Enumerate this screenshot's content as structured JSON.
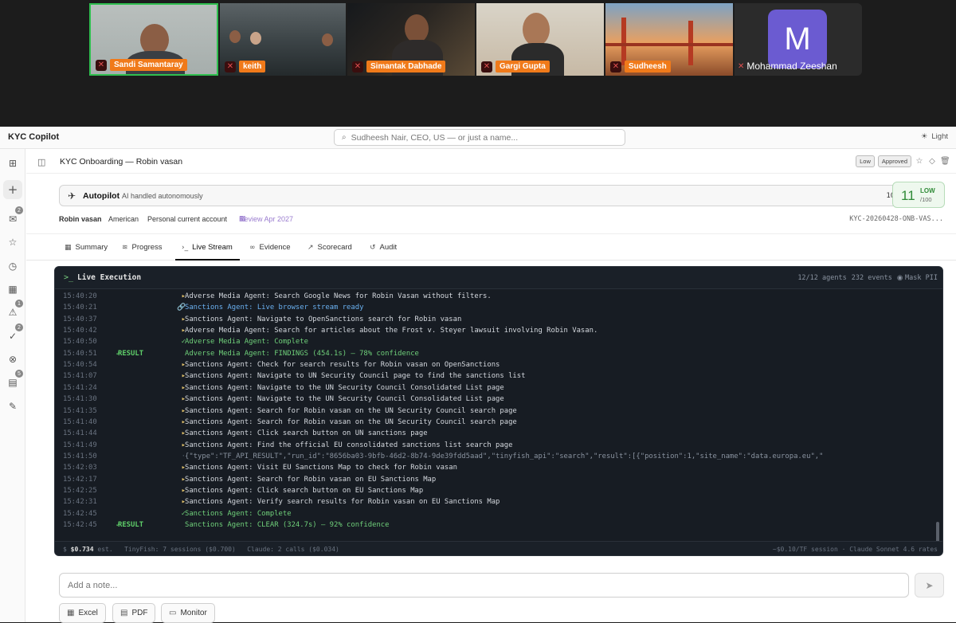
{
  "video_strip": {
    "participants": [
      {
        "name": "Sandi Samantaray"
      },
      {
        "name": "keith"
      },
      {
        "name": "Simantak Dabhade"
      },
      {
        "name": "Gargi Gupta"
      },
      {
        "name": "Sudheesh"
      },
      {
        "name": "Mohammad Zeeshan",
        "initial": "M",
        "avatar_color": "#6b5bd1"
      }
    ],
    "active_speaker_color": "#2fbf4f",
    "name_tag_color": "#f07a1a"
  },
  "app": {
    "brand": "KYC Copilot",
    "search_placeholder": "Sudheesh Nair, CEO, US — or just a name...",
    "theme_label": "Light",
    "rail_badges": {
      "inbox": "2",
      "alerts": "1",
      "checks": "2",
      "archive": "5"
    }
  },
  "header": {
    "title": "KYC Onboarding — Robin vasan",
    "risk_pill": "Low",
    "status_pill": "Approved"
  },
  "autopilot": {
    "label": "Autopilot",
    "subtitle": "AI handled autonomously",
    "percent": "100%"
  },
  "score": {
    "value": "11",
    "level": "LOW",
    "out_of": "/100",
    "color": "#2e8a36"
  },
  "meta": {
    "name": "Robin vasan",
    "nationality": "American",
    "account": "Personal current account",
    "review": "Review Apr 2027",
    "case_id": "KYC-20260428-ONB-VAS..."
  },
  "tabs": [
    {
      "label": "Summary",
      "icon": "grid-icon"
    },
    {
      "label": "Progress",
      "icon": "layers-icon"
    },
    {
      "label": "Live Stream",
      "icon": "terminal-icon"
    },
    {
      "label": "Evidence",
      "icon": "link-icon"
    },
    {
      "label": "Scorecard",
      "icon": "trend-icon"
    },
    {
      "label": "Audit",
      "icon": "history-icon"
    }
  ],
  "terminal": {
    "title": "Live Execution",
    "agents": "12/12 agents",
    "events": "232 events",
    "mask": "Mask PII",
    "logs": [
      {
        "t": "15:40:20",
        "kind": "step",
        "text": "Adverse Media Agent: Search Google News for Robin Vasan without filters."
      },
      {
        "t": "15:40:21",
        "kind": "link",
        "text": "Sanctions Agent: Live browser stream ready"
      },
      {
        "t": "15:40:37",
        "kind": "step",
        "text": "Sanctions Agent: Navigate to OpenSanctions search for Robin vasan"
      },
      {
        "t": "15:40:42",
        "kind": "step",
        "text": "Adverse Media Agent: Search for articles about the Frost v. Steyer lawsuit involving Robin Vasan."
      },
      {
        "t": "15:40:50",
        "kind": "done",
        "text": "Adverse Media Agent: Complete"
      },
      {
        "t": "15:40:51",
        "kind": "result",
        "text": "Adverse Media Agent: FINDINGS (454.1s) — 78% confidence"
      },
      {
        "t": "15:40:54",
        "kind": "step",
        "text": "Sanctions Agent: Check for search results for Robin vasan on OpenSanctions"
      },
      {
        "t": "15:41:07",
        "kind": "step",
        "text": "Sanctions Agent: Navigate to UN Security Council page to find the sanctions list"
      },
      {
        "t": "15:41:24",
        "kind": "step",
        "text": "Sanctions Agent: Navigate to the UN Security Council Consolidated List page"
      },
      {
        "t": "15:41:30",
        "kind": "step",
        "text": "Sanctions Agent: Navigate to the UN Security Council Consolidated List page"
      },
      {
        "t": "15:41:35",
        "kind": "step",
        "text": "Sanctions Agent: Search for Robin vasan on the UN Security Council search page"
      },
      {
        "t": "15:41:40",
        "kind": "step",
        "text": "Sanctions Agent: Search for Robin vasan on the UN Security Council search page"
      },
      {
        "t": "15:41:44",
        "kind": "step",
        "text": "Sanctions Agent: Click search button on UN sanctions page"
      },
      {
        "t": "15:41:49",
        "kind": "step",
        "text": "Sanctions Agent: Find the official EU consolidated sanctions list search page"
      },
      {
        "t": "15:41:50",
        "kind": "json",
        "text": "{\"type\":\"TF_API_RESULT\",\"run_id\":\"8656ba03-9bfb-46d2-8b74-9de39fdd5aad\",\"tinyfish_api\":\"search\",\"result\":[{\"position\":1,\"site_name\":\"data.europa.eu\",\""
      },
      {
        "t": "15:42:03",
        "kind": "step",
        "text": "Sanctions Agent: Visit EU Sanctions Map to check for Robin vasan"
      },
      {
        "t": "15:42:17",
        "kind": "step",
        "text": "Sanctions Agent: Search for Robin vasan on EU Sanctions Map"
      },
      {
        "t": "15:42:25",
        "kind": "step",
        "text": "Sanctions Agent: Click search button on EU Sanctions Map"
      },
      {
        "t": "15:42:31",
        "kind": "step",
        "text": "Sanctions Agent: Verify search results for Robin vasan on EU Sanctions Map"
      },
      {
        "t": "15:42:45",
        "kind": "done",
        "text": "Sanctions Agent: Complete"
      },
      {
        "t": "15:42:45",
        "kind": "result",
        "text": "Sanctions Agent: CLEAR (324.7s) — 92% confidence"
      }
    ],
    "result_label": "RESULT",
    "footer_cost": "$0.734",
    "footer_est": "est.",
    "footer_tinyfish": "TinyFish: 7 sessions ($0.700)",
    "footer_claude": "Claude: 2 calls ($0.034)",
    "footer_right": "~$0.10/TF session · Claude Sonnet 4.6 rates"
  },
  "composer": {
    "placeholder": "Add a note...",
    "actions": [
      {
        "label": "Excel",
        "icon": "table-icon"
      },
      {
        "label": "PDF",
        "icon": "file-icon"
      },
      {
        "label": "Monitor",
        "icon": "monitor-icon"
      }
    ]
  }
}
